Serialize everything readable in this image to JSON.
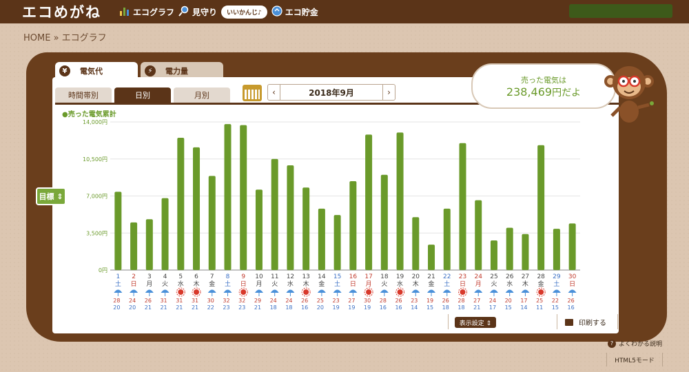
{
  "header": {
    "logo": "エコめがね",
    "nav": [
      {
        "label": "エコグラフ",
        "icon": "bar-graph-icon"
      },
      {
        "label": "見守り",
        "icon": "magnifier-icon"
      },
      {
        "label": "エコ貯金",
        "icon": "coin-icon"
      }
    ],
    "bubble": "いいかんじ♪"
  },
  "breadcrumb": "HOME » エコグラフ",
  "tabs": [
    {
      "label": "電気代",
      "icon": "yen-icon",
      "active": true
    },
    {
      "label": "電力量",
      "icon": "lightning-icon",
      "active": false
    }
  ],
  "subtabs": [
    {
      "label": "時間帯別",
      "active": false
    },
    {
      "label": "日別",
      "active": true
    },
    {
      "label": "月別",
      "active": false
    }
  ],
  "month_label": "2018年9月",
  "sold": {
    "label": "売った電気は",
    "amount": "238,469",
    "suffix": "円だよ"
  },
  "legend": "●売った電気累計",
  "goal_button": "目標 ⇕",
  "display_settings": "表示設定 ⇕",
  "print": "印刷する",
  "help": "よくわかる説明",
  "html5": "HTML5モード",
  "colors": {
    "bar": "#6a9a2a",
    "header": "#5b3418",
    "sat": "#3a6fc4",
    "sun": "#c0392b"
  },
  "chart_data": {
    "type": "bar",
    "yticks": [
      "0円",
      "3,500円",
      "7,000円",
      "10,500円",
      "14,000円"
    ],
    "ylim": [
      0,
      14000
    ],
    "categories": [
      "1",
      "2",
      "3",
      "4",
      "5",
      "6",
      "7",
      "8",
      "9",
      "10",
      "11",
      "12",
      "13",
      "14",
      "15",
      "16",
      "17",
      "18",
      "19",
      "20",
      "21",
      "22",
      "23",
      "24",
      "25",
      "26",
      "27",
      "28",
      "29",
      "30"
    ],
    "weekdays": [
      "土",
      "日",
      "月",
      "火",
      "水",
      "木",
      "金",
      "土",
      "日",
      "月",
      "火",
      "水",
      "木",
      "金",
      "土",
      "日",
      "月",
      "火",
      "水",
      "木",
      "金",
      "土",
      "日",
      "月",
      "火",
      "水",
      "木",
      "金",
      "土",
      "日"
    ],
    "day_colors": [
      "sat",
      "sun",
      "",
      "",
      "",
      "",
      "",
      "sat",
      "sun",
      "",
      "",
      "",
      "",
      "",
      "sat",
      "sun",
      "sun",
      "",
      "",
      "",
      "",
      "sat",
      "sun",
      "sun",
      "",
      "",
      "",
      "",
      "sat",
      "sun"
    ],
    "values": [
      7400,
      4500,
      4800,
      6800,
      12500,
      11600,
      8900,
      13800,
      13700,
      7600,
      10500,
      9900,
      7800,
      5800,
      5200,
      8400,
      12800,
      9000,
      13000,
      5000,
      2400,
      5800,
      12000,
      6600,
      2800,
      4000,
      3400,
      11800,
      3900,
      4400
    ],
    "weather": [
      "umbrella",
      "umbrella",
      "umbrella",
      "umbrella",
      "sun",
      "sun",
      "umbrella",
      "umbrella",
      "sun",
      "umbrella",
      "umbrella",
      "umbrella",
      "sun",
      "umbrella",
      "umbrella",
      "umbrella",
      "sun",
      "umbrella",
      "sun",
      "umbrella",
      "umbrella",
      "umbrella",
      "sun",
      "umbrella",
      "umbrella",
      "umbrella",
      "umbrella",
      "sun",
      "umbrella",
      "umbrella"
    ],
    "high": [
      "28",
      "24",
      "26",
      "31",
      "31",
      "31",
      "30",
      "32",
      "32",
      "29",
      "24",
      "24",
      "26",
      "25",
      "23",
      "27",
      "30",
      "28",
      "26",
      "23",
      "19",
      "26",
      "28",
      "27",
      "24",
      "20",
      "17",
      "25",
      "22",
      "26"
    ],
    "low": [
      "20",
      "20",
      "21",
      "21",
      "21",
      "21",
      "22",
      "23",
      "23",
      "21",
      "18",
      "18",
      "16",
      "20",
      "19",
      "19",
      "19",
      "16",
      "16",
      "14",
      "15",
      "18",
      "18",
      "21",
      "17",
      "15",
      "14",
      "11",
      "15",
      "16"
    ]
  }
}
